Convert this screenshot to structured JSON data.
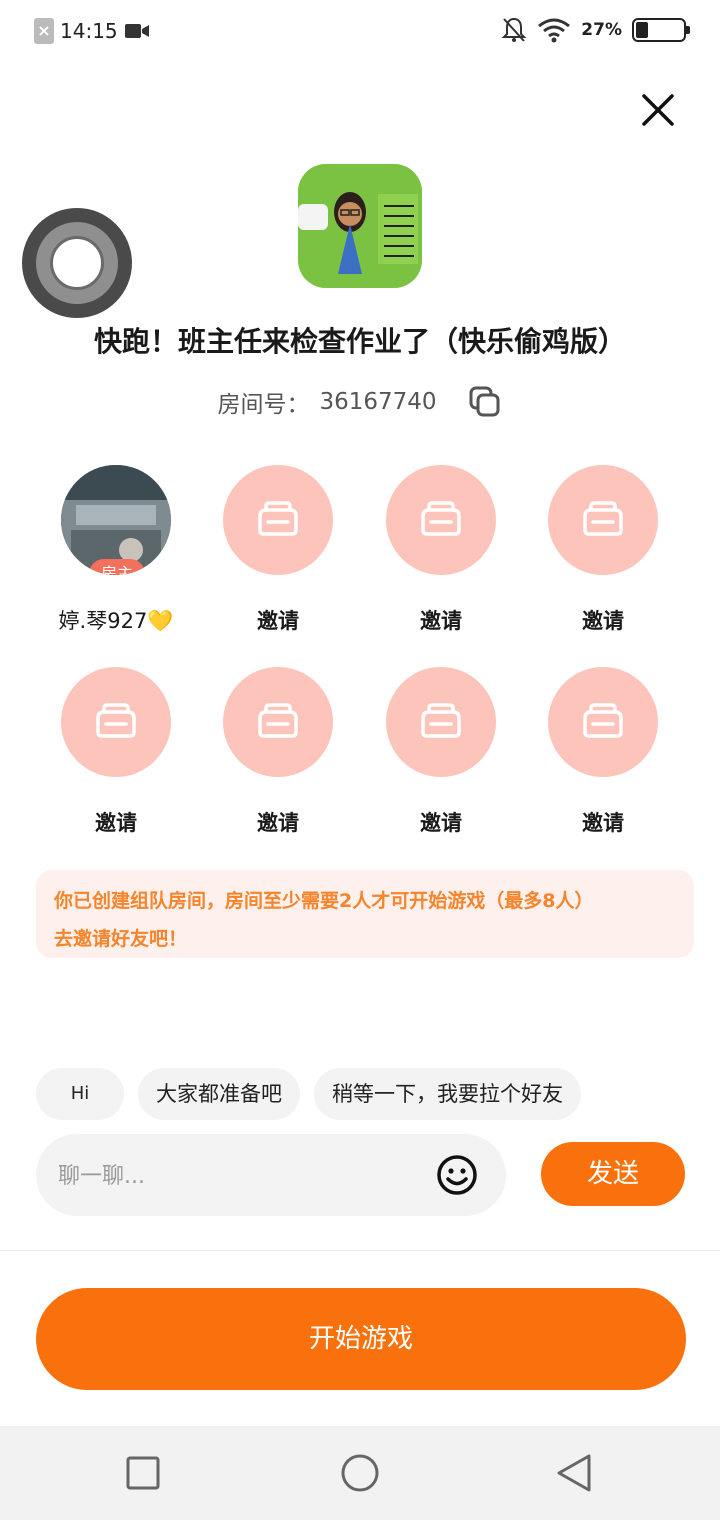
{
  "status_bar": {
    "time": "14:15",
    "battery_pct": "27%",
    "battery_level": 0.27,
    "icons": [
      "close-notification-icon",
      "video-icon",
      "mute-icon",
      "wifi-icon",
      "battery-icon"
    ]
  },
  "game": {
    "title": "快跑！班主任来检查作业了（快乐偷鸡版）",
    "icon": "game-cover-icon"
  },
  "room": {
    "label": "房间号：",
    "number": "36167740",
    "copy_icon": "copy-icon"
  },
  "host": {
    "badge": "房主",
    "name": "婷.琴927💛"
  },
  "invite_label": "邀请",
  "notice": {
    "line1": "你已创建组队房间，房间至少需要2人才可开始游戏（最多8人）",
    "line2": "去邀请好友吧！"
  },
  "quick_replies": [
    "Hi",
    "大家都准备吧",
    "稍等一下，我要拉个好友"
  ],
  "chat": {
    "placeholder": "聊一聊...",
    "send_label": "发送"
  },
  "start_button": "开始游戏",
  "colors": {
    "accent": "#f8710d",
    "slot_pink": "#fcc4ba",
    "notice_bg": "#fef0ec",
    "notice_text": "#f5842a"
  }
}
